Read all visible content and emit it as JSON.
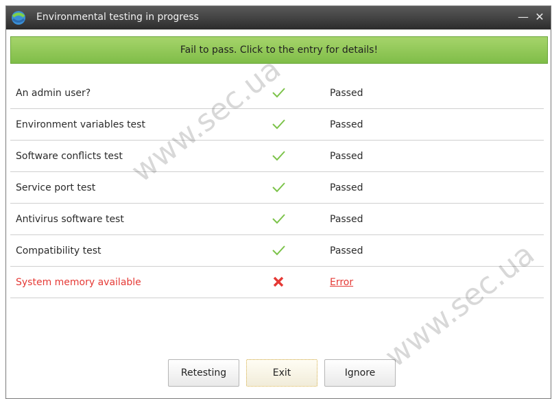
{
  "window": {
    "title": "Environmental testing in progress",
    "minimize_label": "—",
    "close_label": "✕"
  },
  "banner": {
    "text": "Fail to pass. Click to the entry for details!"
  },
  "tests": [
    {
      "name": "An admin user?",
      "status": "Passed",
      "result": "pass"
    },
    {
      "name": "Environment variables test",
      "status": "Passed",
      "result": "pass"
    },
    {
      "name": "Software conflicts test",
      "status": "Passed",
      "result": "pass"
    },
    {
      "name": "Service port test",
      "status": "Passed",
      "result": "pass"
    },
    {
      "name": "Antivirus software test",
      "status": "Passed",
      "result": "pass"
    },
    {
      "name": "Compatibility test",
      "status": "Passed",
      "result": "pass"
    },
    {
      "name": "System memory available",
      "status": "Error",
      "result": "error"
    }
  ],
  "buttons": {
    "retesting": "Retesting",
    "exit": "Exit",
    "ignore": "Ignore"
  },
  "watermarks": [
    "www.sec.ua",
    "www.sec.ua"
  ],
  "icons": {
    "pass": "check-icon",
    "error": "x-icon"
  },
  "colors": {
    "pass": "#7cc34a",
    "error": "#e53935",
    "banner": "#8cc652"
  }
}
